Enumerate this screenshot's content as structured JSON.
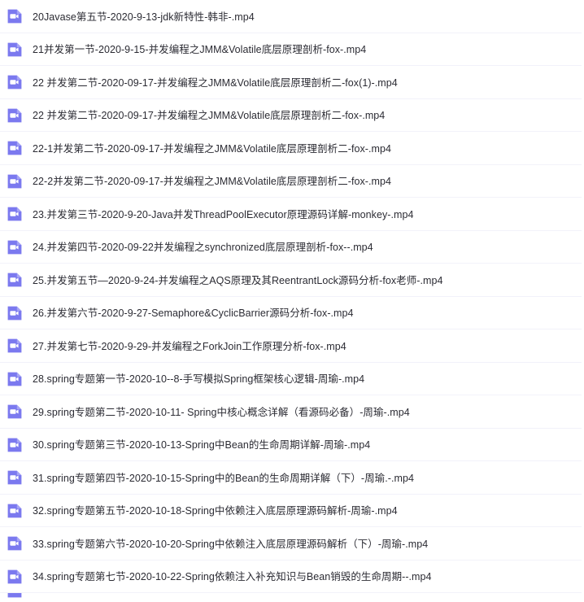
{
  "list": {
    "name": "video-file-list",
    "icon_name": "video-file-icon",
    "icon_color": "#7b79ef",
    "icon_fold_color": "#a6a4f5",
    "icon_glyph_color": "#ffffff",
    "text_color": "#2b2b33",
    "row_separator_color": "#f2f2fa",
    "background_color": "#ffffff",
    "files": [
      {
        "name": "20Javase第五节-2020-9-13-jdk新特性-韩非-.mp4"
      },
      {
        "name": "21并发第一节-2020-9-15-并发编程之JMM&Volatile底层原理剖析-fox-.mp4"
      },
      {
        "name": "22 并发第二节-2020-09-17-并发编程之JMM&Volatile底层原理剖析二-fox(1)-.mp4"
      },
      {
        "name": "22 并发第二节-2020-09-17-并发编程之JMM&Volatile底层原理剖析二-fox-.mp4"
      },
      {
        "name": "22-1并发第二节-2020-09-17-并发编程之JMM&Volatile底层原理剖析二-fox-.mp4"
      },
      {
        "name": "22-2并发第二节-2020-09-17-并发编程之JMM&Volatile底层原理剖析二-fox-.mp4"
      },
      {
        "name": "23.并发第三节-2020-9-20-Java并发ThreadPoolExecutor原理源码详解-monkey-.mp4"
      },
      {
        "name": "24.并发第四节-2020-09-22并发编程之synchronized底层原理剖析-fox--.mp4"
      },
      {
        "name": "25.并发第五节—2020-9-24-并发编程之AQS原理及其ReentrantLock源码分析-fox老师-.mp4"
      },
      {
        "name": "26.并发第六节-2020-9-27-Semaphore&CyclicBarrier源码分析-fox-.mp4"
      },
      {
        "name": "27.并发第七节-2020-9-29-并发编程之ForkJoin工作原理分析-fox-.mp4"
      },
      {
        "name": "28.spring专题第一节-2020-10--8-手写模拟Spring框架核心逻辑-周瑜-.mp4"
      },
      {
        "name": "29.spring专题第二节-2020-10-11- Spring中核心概念详解（看源码必备）-周瑜-.mp4"
      },
      {
        "name": "30.spring专题第三节-2020-10-13-Spring中Bean的生命周期详解-周瑜-.mp4"
      },
      {
        "name": "31.spring专题第四节-2020-10-15-Spring中的Bean的生命周期详解（下）-周瑜.-.mp4"
      },
      {
        "name": "32.spring专题第五节-2020-10-18-Spring中依赖注入底层原理源码解析-周瑜-.mp4"
      },
      {
        "name": "33.spring专题第六节-2020-10-20-Spring中依赖注入底层原理源码解析（下）-周瑜-.mp4"
      },
      {
        "name": "34.spring专题第七节-2020-10-22-Spring依赖注入补充知识与Bean销毁的生命周期--.mp4"
      },
      {
        "name": ""
      }
    ]
  }
}
